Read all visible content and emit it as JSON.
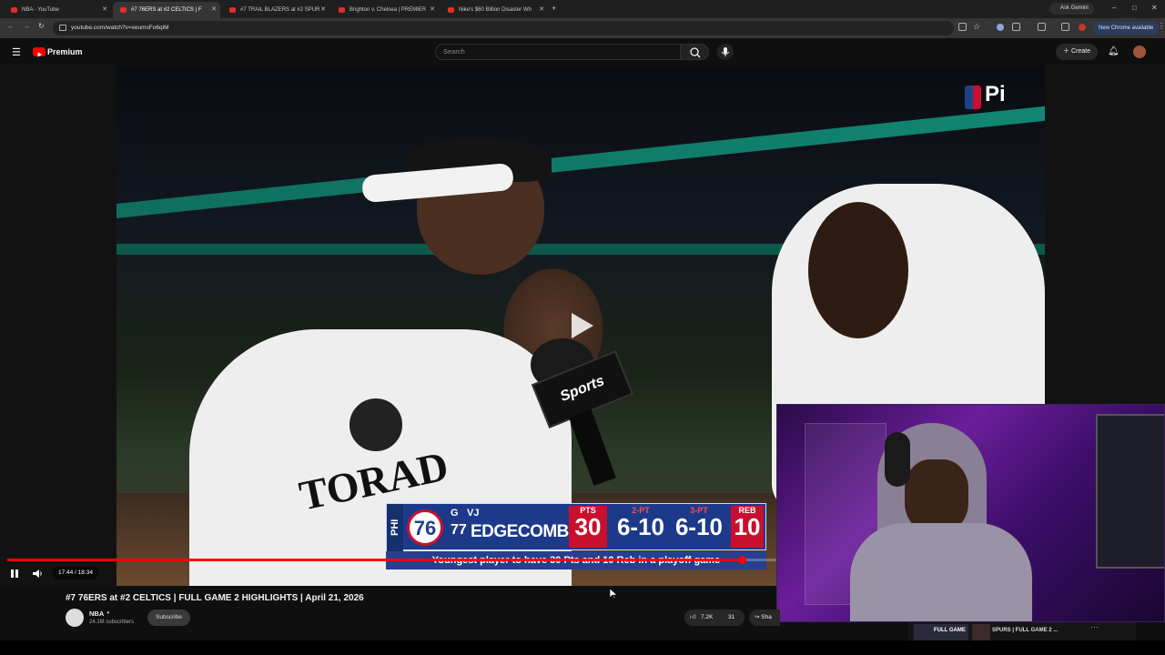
{
  "browser": {
    "tabs": [
      {
        "title": "NBA - YouTube",
        "active": false
      },
      {
        "title": "#7 76ERS at #2 CELTICS | F",
        "active": true
      },
      {
        "title": "#7 TRAIL BLAZERS at #2 SPUR",
        "active": false
      },
      {
        "title": "Brighton v. Chelsea | PREMIER",
        "active": false
      },
      {
        "title": "Nike's $60 Billion Disaster Wh",
        "active": false
      }
    ],
    "new_tab": "+",
    "url": "youtube.com/watch?v=xeumsFo6qiM",
    "ask_gemini": "Ask Gemini",
    "update_pill": "New Chrome available",
    "window_controls": [
      "–",
      "□",
      "✕"
    ]
  },
  "youtube": {
    "logo_text": "Premium",
    "search_placeholder": "Search",
    "create_label": "Create"
  },
  "player": {
    "current_time": "17:44",
    "duration": "18:34",
    "time_display": "17:44 / 18:34",
    "progress_fraction": 0.955,
    "scorebug": {
      "team": "PHI",
      "position": "G",
      "initials": "VJ",
      "number": "77",
      "name": "EDGECOMBE",
      "stats": [
        {
          "label": "PTS",
          "value": "30"
        },
        {
          "label": "2-PT",
          "value": "6-10"
        },
        {
          "label": "3-PT",
          "value": "6-10"
        },
        {
          "label": "REB",
          "value": "10"
        }
      ],
      "note": "Youngest player to have 30 Pts and 10 Reb in a playoff game"
    },
    "broadcast_mic": "Sports",
    "watermark": "Pi"
  },
  "video": {
    "title": "#7 76ERS at #2 CELTICS | FULL GAME 2 HIGHLIGHTS | April 21, 2026",
    "channel": "NBA",
    "subscribers": "24.1M subscribers",
    "subscribe_label": "Subscribe",
    "likes": "7.2K",
    "comments": "31",
    "share_label": "Sha"
  },
  "up_next": {
    "label1": "FULL GAME",
    "label2": "SPURS | FULL GAME 2 ..."
  },
  "colors": {
    "accent_red": "#ff0000",
    "scorebug_blue": "#1d3a8a",
    "celtics_green": "#118673"
  }
}
